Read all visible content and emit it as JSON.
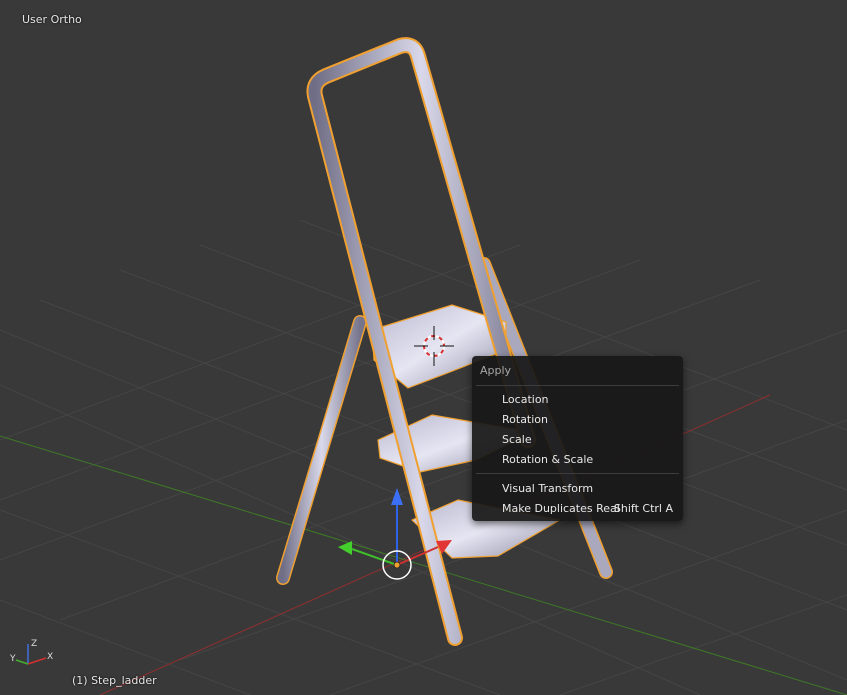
{
  "viewport": {
    "view_name": "User Ortho",
    "object_info": "(1) Step_ladder",
    "background_color": "#393939",
    "selection_outline_color": "#f0a030"
  },
  "apply_menu": {
    "title": "Apply",
    "items": [
      {
        "label": "Location",
        "shortcut": ""
      },
      {
        "label": "Rotation",
        "shortcut": ""
      },
      {
        "label": "Scale",
        "shortcut": ""
      },
      {
        "label": "Rotation & Scale",
        "shortcut": ""
      },
      {
        "label": "Visual Transform",
        "shortcut": ""
      },
      {
        "label": "Make Duplicates Real",
        "shortcut": "Shift Ctrl A"
      }
    ]
  },
  "axis_gizmo": {
    "x_label": "X",
    "y_label": "Y",
    "z_label": "Z"
  },
  "icons": [
    "3d-cursor-icon",
    "transform-manipulator-icon",
    "axis-gizmo-icon"
  ]
}
